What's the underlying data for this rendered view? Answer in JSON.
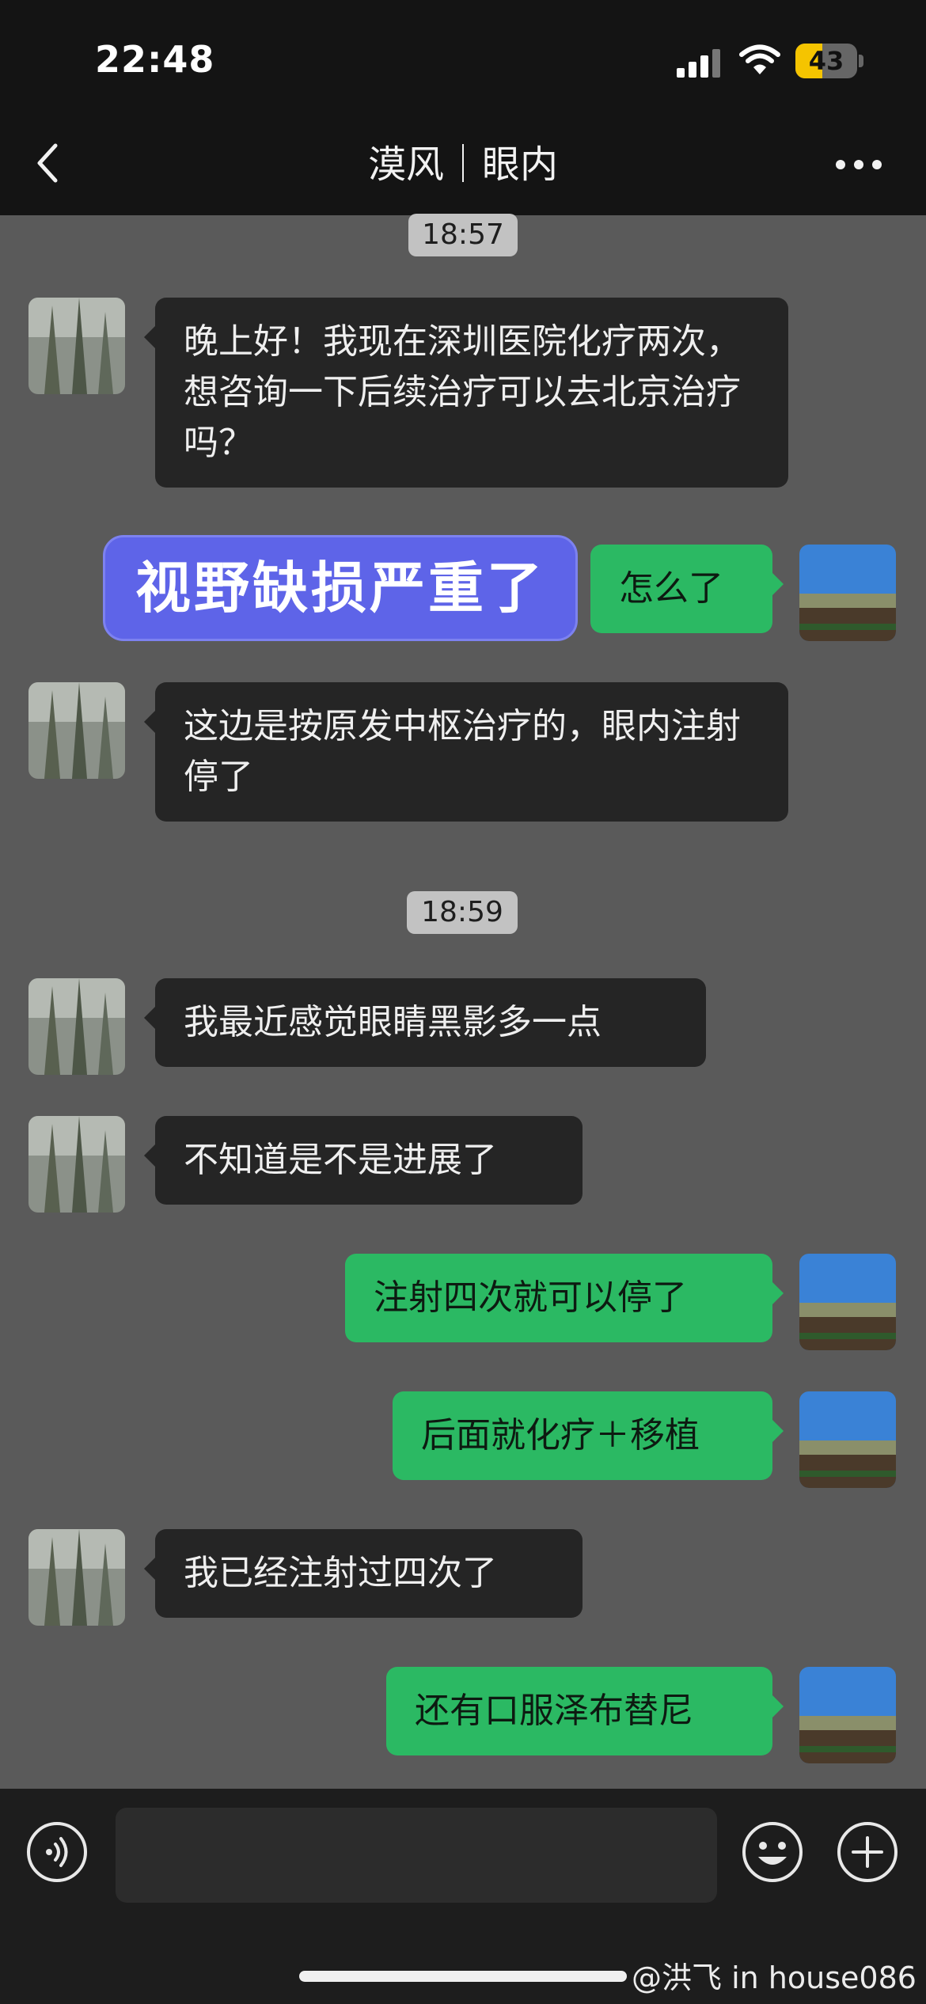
{
  "status_bar": {
    "time": "22:48",
    "battery": "43",
    "battery_level": 0.43
  },
  "header": {
    "title": "漠风｜眼内"
  },
  "timestamps": [
    "18:57",
    "18:59"
  ],
  "messages": [
    {
      "side": "left",
      "text": "晚上好！我现在深圳医院化疗两次，想咨询一下后续治疗可以去北京治疗吗？"
    },
    {
      "side": "right",
      "text": "怎么了"
    },
    {
      "side": "left",
      "text": "这边是按原发中枢治疗的，眼内注射停了"
    },
    {
      "side": "left",
      "text": "我最近感觉眼睛黑影多一点"
    },
    {
      "side": "left",
      "text": "不知道是不是进展了"
    },
    {
      "side": "right",
      "text": "注射四次就可以停了"
    },
    {
      "side": "right",
      "text": "后面就化疗＋移植"
    },
    {
      "side": "left",
      "text": "我已经注射过四次了"
    },
    {
      "side": "right",
      "text": "还有口服泽布替尼"
    }
  ],
  "overlay_label": "视野缺损严重了",
  "input_bar": {
    "placeholder": ""
  },
  "watermark": "@洪飞 in house086",
  "icons": {
    "back": "chevron-left-icon",
    "more": "more-dots-icon",
    "voice": "voice-icon",
    "emoji": "emoji-icon",
    "add": "plus-icon"
  },
  "colors": {
    "chat_background": "#5a5a5a",
    "incoming_bubble": "#252525",
    "outgoing_bubble": "#2bb963",
    "overlay_label": "#5e64e8",
    "battery": "#f5c400"
  }
}
